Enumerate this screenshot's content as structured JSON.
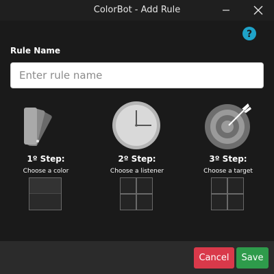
{
  "window": {
    "title": "ColorBot - Add Rule",
    "minimize_icon": "minimize-icon",
    "close_icon": "close-icon"
  },
  "help_icon": "help-circle-icon",
  "form": {
    "rule_name_label": "Rule Name",
    "rule_name_value": "",
    "rule_name_placeholder": "Enter rule name"
  },
  "steps": [
    {
      "title": "1º Step:",
      "subtitle": "Choose a color",
      "icon": "color-swatch-icon"
    },
    {
      "title": "2º Step:",
      "subtitle": "Choose a listener",
      "icon": "clock-icon"
    },
    {
      "title": "3º Step:",
      "subtitle": "Choose a target",
      "icon": "target-icon"
    }
  ],
  "buttons": {
    "cancel": "Cancel",
    "save": "Save"
  },
  "colors": {
    "cancel": "#d9394a",
    "save": "#2e9b4b",
    "help": "#1fa3c9",
    "content_bg": "#1a1a1a"
  }
}
